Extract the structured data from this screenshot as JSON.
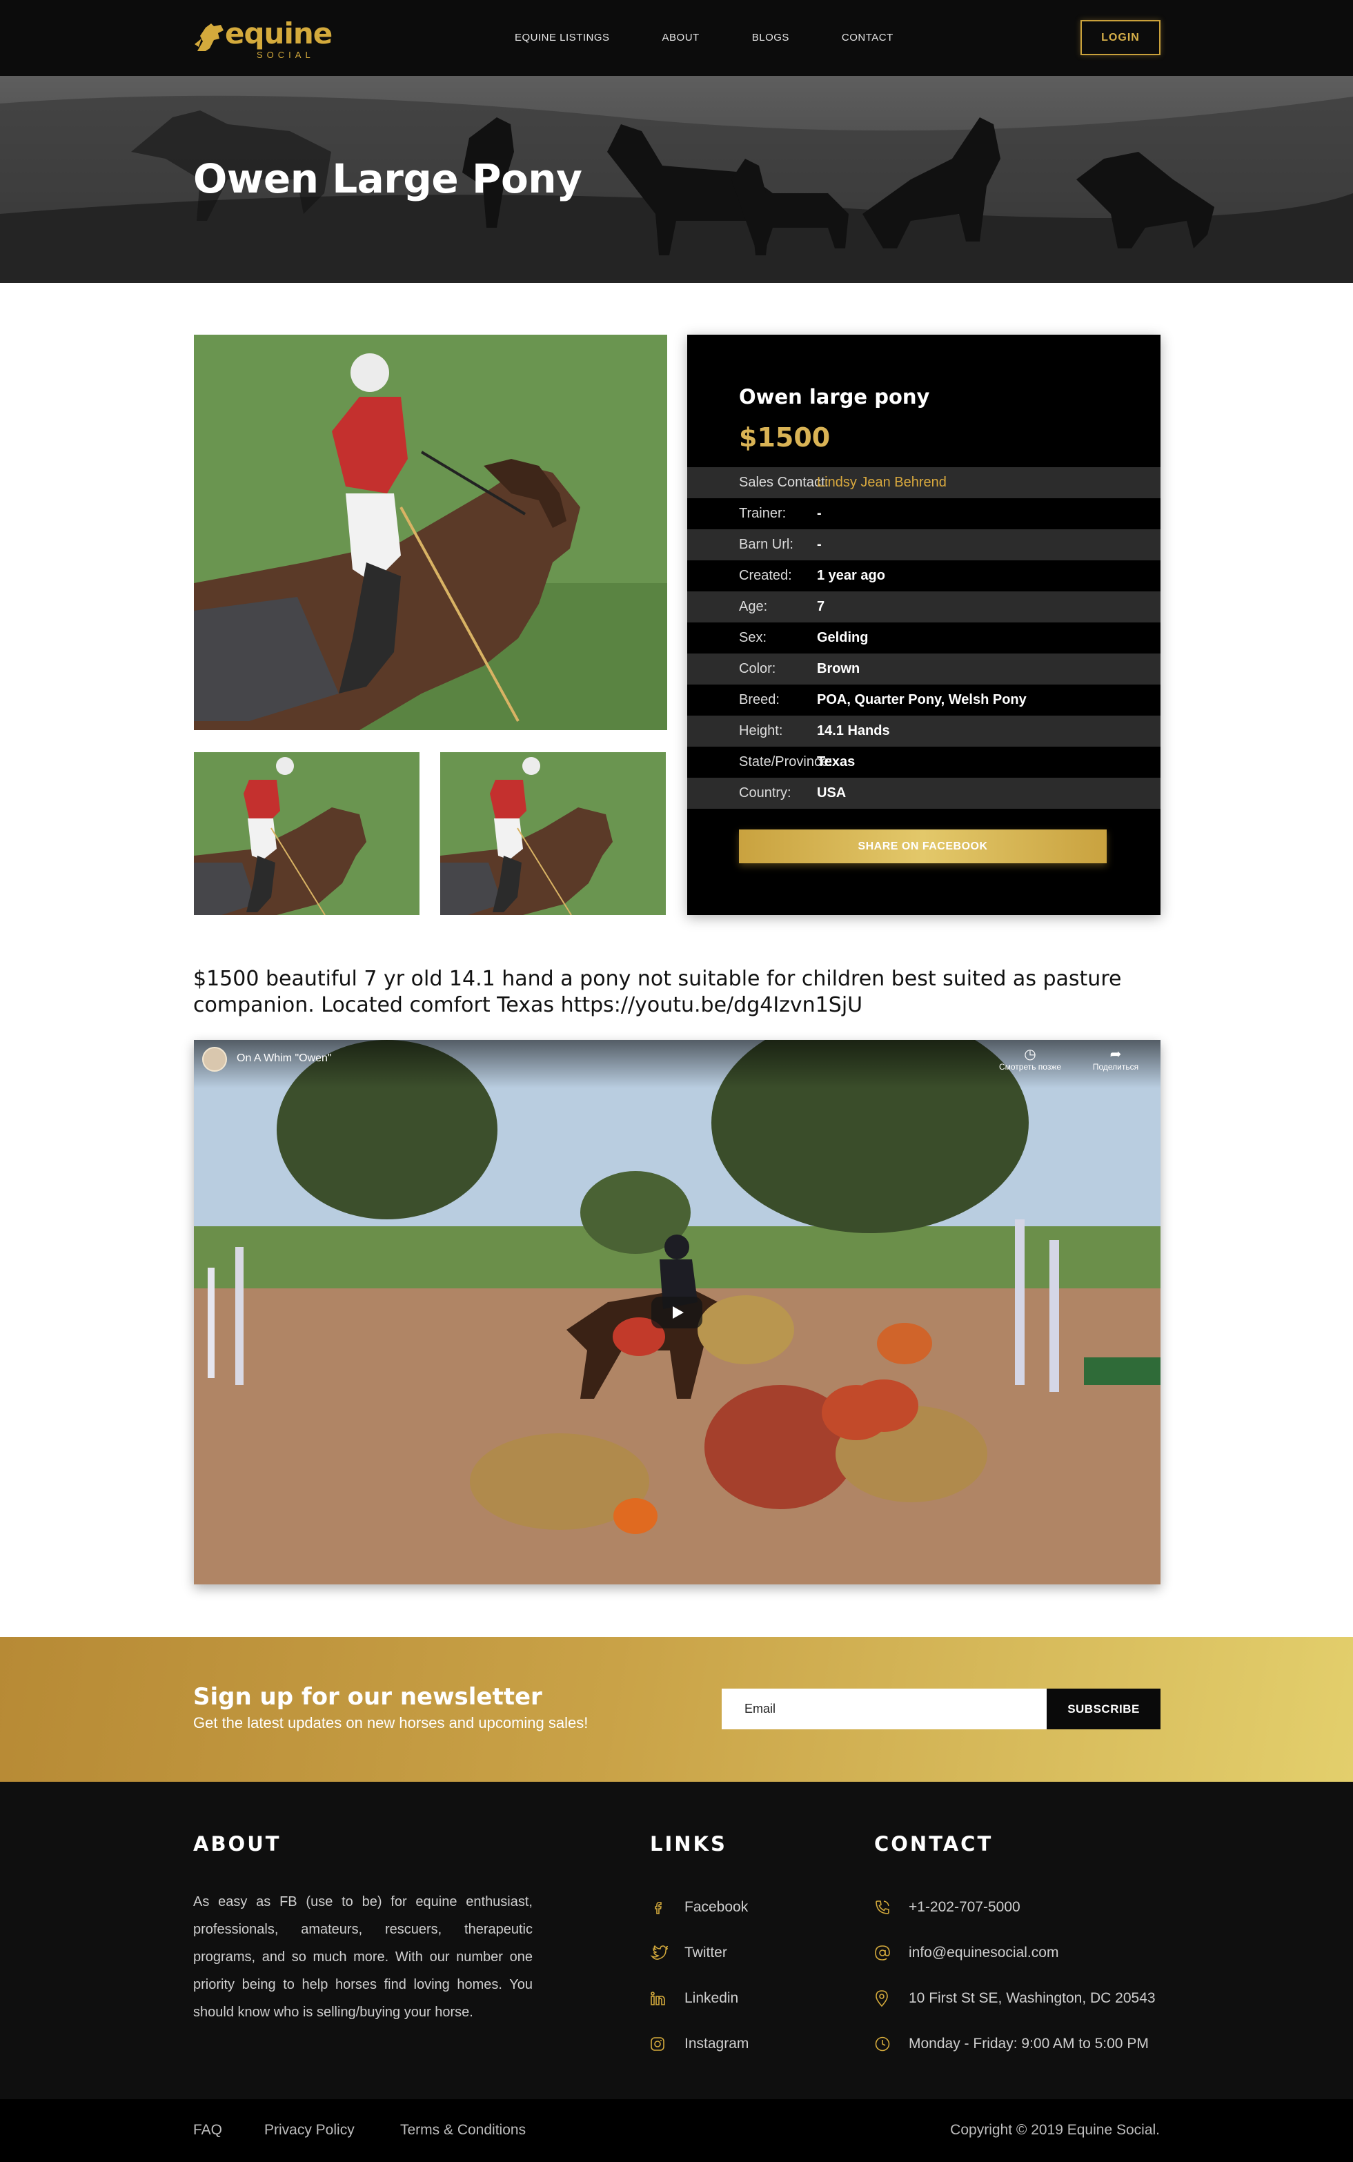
{
  "header": {
    "logo_word": "equine",
    "logo_sub": "SOCIAL",
    "nav": [
      "EQUINE LISTINGS",
      "ABOUT",
      "BLOGS",
      "CONTACT"
    ],
    "login_label": "LOGIN"
  },
  "hero": {
    "title": "Owen Large Pony"
  },
  "listing": {
    "title": "Owen large pony",
    "price": "$1500",
    "specs": [
      {
        "label": "Sales Contact:",
        "value": "Lindsy Jean Behrend"
      },
      {
        "label": "Trainer:",
        "value": "-"
      },
      {
        "label": "Barn Url:",
        "value": "-"
      },
      {
        "label": "Created:",
        "value": "1 year ago"
      },
      {
        "label": "Age:",
        "value": "7"
      },
      {
        "label": "Sex:",
        "value": "Gelding"
      },
      {
        "label": "Color:",
        "value": "Brown"
      },
      {
        "label": "Breed:",
        "value": "POA, Quarter Pony, Welsh Pony"
      },
      {
        "label": "Height:",
        "value": "14.1 Hands"
      },
      {
        "label": "State/Province:",
        "value": "Texas"
      },
      {
        "label": "Country:",
        "value": "USA"
      }
    ],
    "share_label": "SHARE ON FACEBOOK",
    "description": "$1500 beautiful 7 yr old 14.1 hand a pony not suitable for children best suited as pasture companion. Located comfort Texas https://youtu.be/dg4Izvn1SjU"
  },
  "video": {
    "title": "On A Whim \"Owen\"",
    "watch_later": "Смотреть позже",
    "share": "Поделиться",
    "watch_icon": "clock-icon",
    "share_icon": "share-arrow-icon"
  },
  "newsletter": {
    "title": "Sign up for our newsletter",
    "subtitle": "Get the latest updates on new horses and upcoming sales!",
    "email_placeholder": "Email",
    "subscribe_label": "SUBSCRIBE"
  },
  "footer": {
    "about_heading": "ABOUT",
    "about_text": "As easy as FB (use to be) for equine enthusiast, professionals, amateurs, rescuers, therapeutic programs, and so much more. With our number one priority being to help horses find loving homes. You should know who is selling/buying your horse.",
    "links_heading": "LINKS",
    "links": [
      {
        "label": "Facebook",
        "icon": "facebook-icon"
      },
      {
        "label": "Twitter",
        "icon": "twitter-icon"
      },
      {
        "label": "Linkedin",
        "icon": "linkedin-icon"
      },
      {
        "label": "Instagram",
        "icon": "instagram-icon"
      }
    ],
    "contact_heading": "CONTACT",
    "contact": [
      {
        "label": "+1-202-707-5000",
        "icon": "phone-icon"
      },
      {
        "label": "info@equinesocial.com",
        "icon": "at-icon"
      },
      {
        "label": "10 First St SE, Washington, DC 20543",
        "icon": "location-pin-icon"
      },
      {
        "label": "Monday - Friday: 9:00 AM to 5:00 PM",
        "icon": "clock-icon"
      }
    ],
    "bottom_links": [
      "FAQ",
      "Privacy Policy",
      "Terms & Conditions"
    ],
    "copyright": "Copyright © 2019 Equine Social."
  },
  "colors": {
    "accent_gold": "#d4aa3c",
    "header_bg": "#0c0c0c",
    "card_bg": "#000000",
    "footer_bg": "#0f0f0f"
  }
}
